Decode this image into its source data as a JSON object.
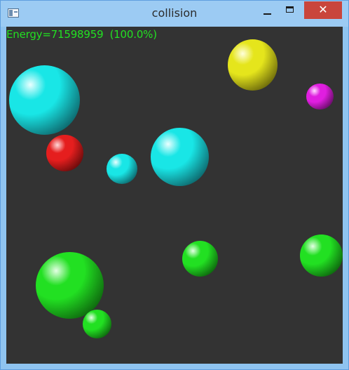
{
  "window": {
    "title": "collision",
    "close_glyph": "✕"
  },
  "hud": {
    "energy_text": "Energy=71598959  (100.0%)",
    "color": "#22e022"
  },
  "colors": {
    "background": "#333333",
    "titlebar": "#9ccbf3",
    "close": "#c9453c"
  },
  "balls": [
    {
      "name": "cyan-ball-large",
      "color": "cyan",
      "base": "#19e6e6",
      "light": "#eaffff",
      "dark": "#0b4f55"
    },
    {
      "name": "yellow-ball",
      "color": "yellow",
      "base": "#e5e51c",
      "light": "#ffffdc",
      "dark": "#555208"
    },
    {
      "name": "magenta-ball",
      "color": "magenta",
      "base": "#e01ee0",
      "light": "#ffdcff",
      "dark": "#500a50"
    },
    {
      "name": "red-ball",
      "color": "red",
      "base": "#e51e1e",
      "light": "#ffd9d9",
      "dark": "#520808"
    },
    {
      "name": "cyan-ball-small",
      "color": "cyan",
      "base": "#19e6e6",
      "light": "#eaffff",
      "dark": "#0b4f55"
    },
    {
      "name": "cyan-ball-medium",
      "color": "cyan",
      "base": "#19e6e6",
      "light": "#eaffff",
      "dark": "#0b4f55"
    },
    {
      "name": "green-ball-right",
      "color": "green",
      "base": "#22e022",
      "light": "#e4ffe4",
      "dark": "#0a4f0a"
    },
    {
      "name": "green-ball-center",
      "color": "green",
      "base": "#22e022",
      "light": "#e4ffe4",
      "dark": "#0a4f0a"
    },
    {
      "name": "green-ball-large",
      "color": "green",
      "base": "#22e022",
      "light": "#e4ffe4",
      "dark": "#0a4f0a"
    },
    {
      "name": "green-ball-small",
      "color": "green",
      "base": "#22e022",
      "light": "#e4ffe4",
      "dark": "#0a4f0a"
    }
  ]
}
